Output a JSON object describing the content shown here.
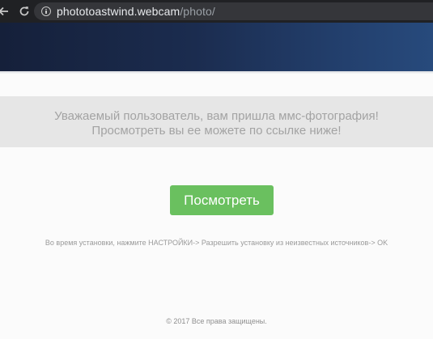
{
  "browser": {
    "back_icon": "back-arrow-icon",
    "reload_icon": "reload-icon",
    "site_info_icon": "info-icon",
    "url_host": "phototoastwind.webcam",
    "url_path": "/photo/"
  },
  "colors": {
    "banner": "#1b2c4f",
    "button": "#6ac05f",
    "message_box": "#e6e6e6"
  },
  "main": {
    "message_line1": "Уважаемый пользователь, вам пришла ммс-фотография!",
    "message_line2": "Просмотреть вы ее можете по ссылке ниже!",
    "view_button_label": "Посмотреть",
    "instruction": "Во время установки, нажмите НАСТРОЙКИ-> Разрешить установку из неизвестных источников-> OK"
  },
  "footer": {
    "copyright": "© 2017 Все права защищены."
  }
}
